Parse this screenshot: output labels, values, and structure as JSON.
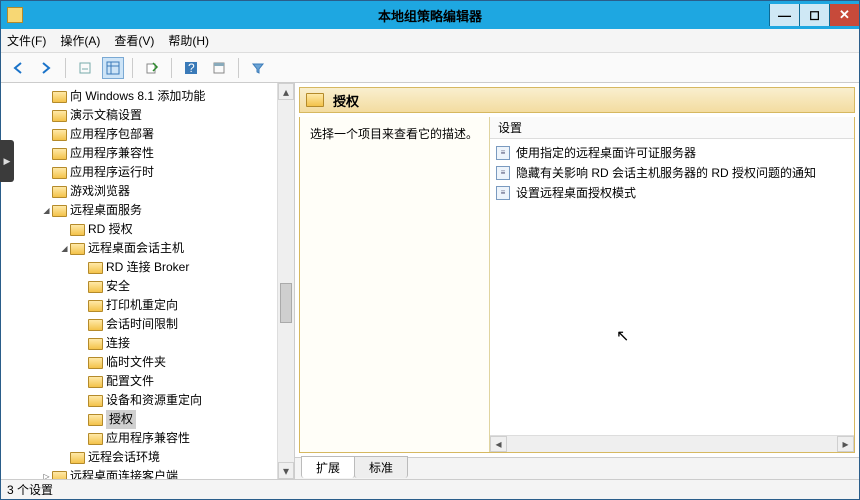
{
  "window": {
    "title": "本地组策略编辑器"
  },
  "menu": {
    "file": "文件(F)",
    "action": "操作(A)",
    "view": "查看(V)",
    "help": "帮助(H)"
  },
  "tree": {
    "items": [
      {
        "indent": 2,
        "exp": "none",
        "label": "向 Windows 8.1 添加功能"
      },
      {
        "indent": 2,
        "exp": "none",
        "label": "演示文稿设置"
      },
      {
        "indent": 2,
        "exp": "none",
        "label": "应用程序包部署"
      },
      {
        "indent": 2,
        "exp": "none",
        "label": "应用程序兼容性"
      },
      {
        "indent": 2,
        "exp": "none",
        "label": "应用程序运行时"
      },
      {
        "indent": 2,
        "exp": "none",
        "label": "游戏浏览器"
      },
      {
        "indent": 2,
        "exp": "open",
        "label": "远程桌面服务"
      },
      {
        "indent": 3,
        "exp": "none",
        "label": "RD 授权"
      },
      {
        "indent": 3,
        "exp": "open",
        "label": "远程桌面会话主机"
      },
      {
        "indent": 4,
        "exp": "none",
        "label": "RD 连接 Broker"
      },
      {
        "indent": 4,
        "exp": "none",
        "label": "安全"
      },
      {
        "indent": 4,
        "exp": "none",
        "label": "打印机重定向"
      },
      {
        "indent": 4,
        "exp": "none",
        "label": "会话时间限制"
      },
      {
        "indent": 4,
        "exp": "none",
        "label": "连接"
      },
      {
        "indent": 4,
        "exp": "none",
        "label": "临时文件夹"
      },
      {
        "indent": 4,
        "exp": "none",
        "label": "配置文件"
      },
      {
        "indent": 4,
        "exp": "none",
        "label": "设备和资源重定向"
      },
      {
        "indent": 4,
        "exp": "none",
        "label": "授权",
        "selected": true
      },
      {
        "indent": 4,
        "exp": "none",
        "label": "应用程序兼容性"
      },
      {
        "indent": 3,
        "exp": "none",
        "label": "远程会话环境"
      },
      {
        "indent": 2,
        "exp": "closed",
        "label": "远程桌面连接客户端"
      }
    ]
  },
  "detail": {
    "heading": "授权",
    "description": "选择一个项目来查看它的描述。",
    "column_header": "设置",
    "settings": [
      "使用指定的远程桌面许可证服务器",
      "隐藏有关影响 RD 会话主机服务器的 RD 授权问题的通知",
      "设置远程桌面授权模式"
    ]
  },
  "tabs": {
    "extended": "扩展",
    "standard": "标准"
  },
  "status": {
    "text": "3 个设置"
  }
}
